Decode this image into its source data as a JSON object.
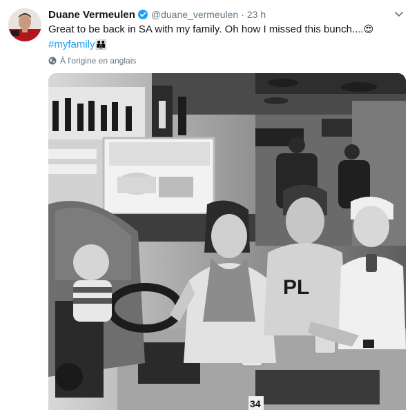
{
  "tweet": {
    "display_name": "Duane Vermeulen",
    "handle": "@duane_vermeulen",
    "separator": "·",
    "time": "23 h",
    "text": "Great to be back in SA with my family. Oh how I missed this bunch....",
    "text_emoji": "😍",
    "hashtag": "#myfamily",
    "hashtag_emoji": "👪",
    "translate_label": "À l'origine en anglais",
    "table_number": "34"
  },
  "icons": {
    "verified": "verified-badge-icon",
    "caret": "chevron-down-icon",
    "globe": "globe-icon"
  },
  "colors": {
    "link": "#1da1f2",
    "secondary_text": "#657786",
    "primary_text": "#14171a",
    "verified": "#1da1f2"
  }
}
